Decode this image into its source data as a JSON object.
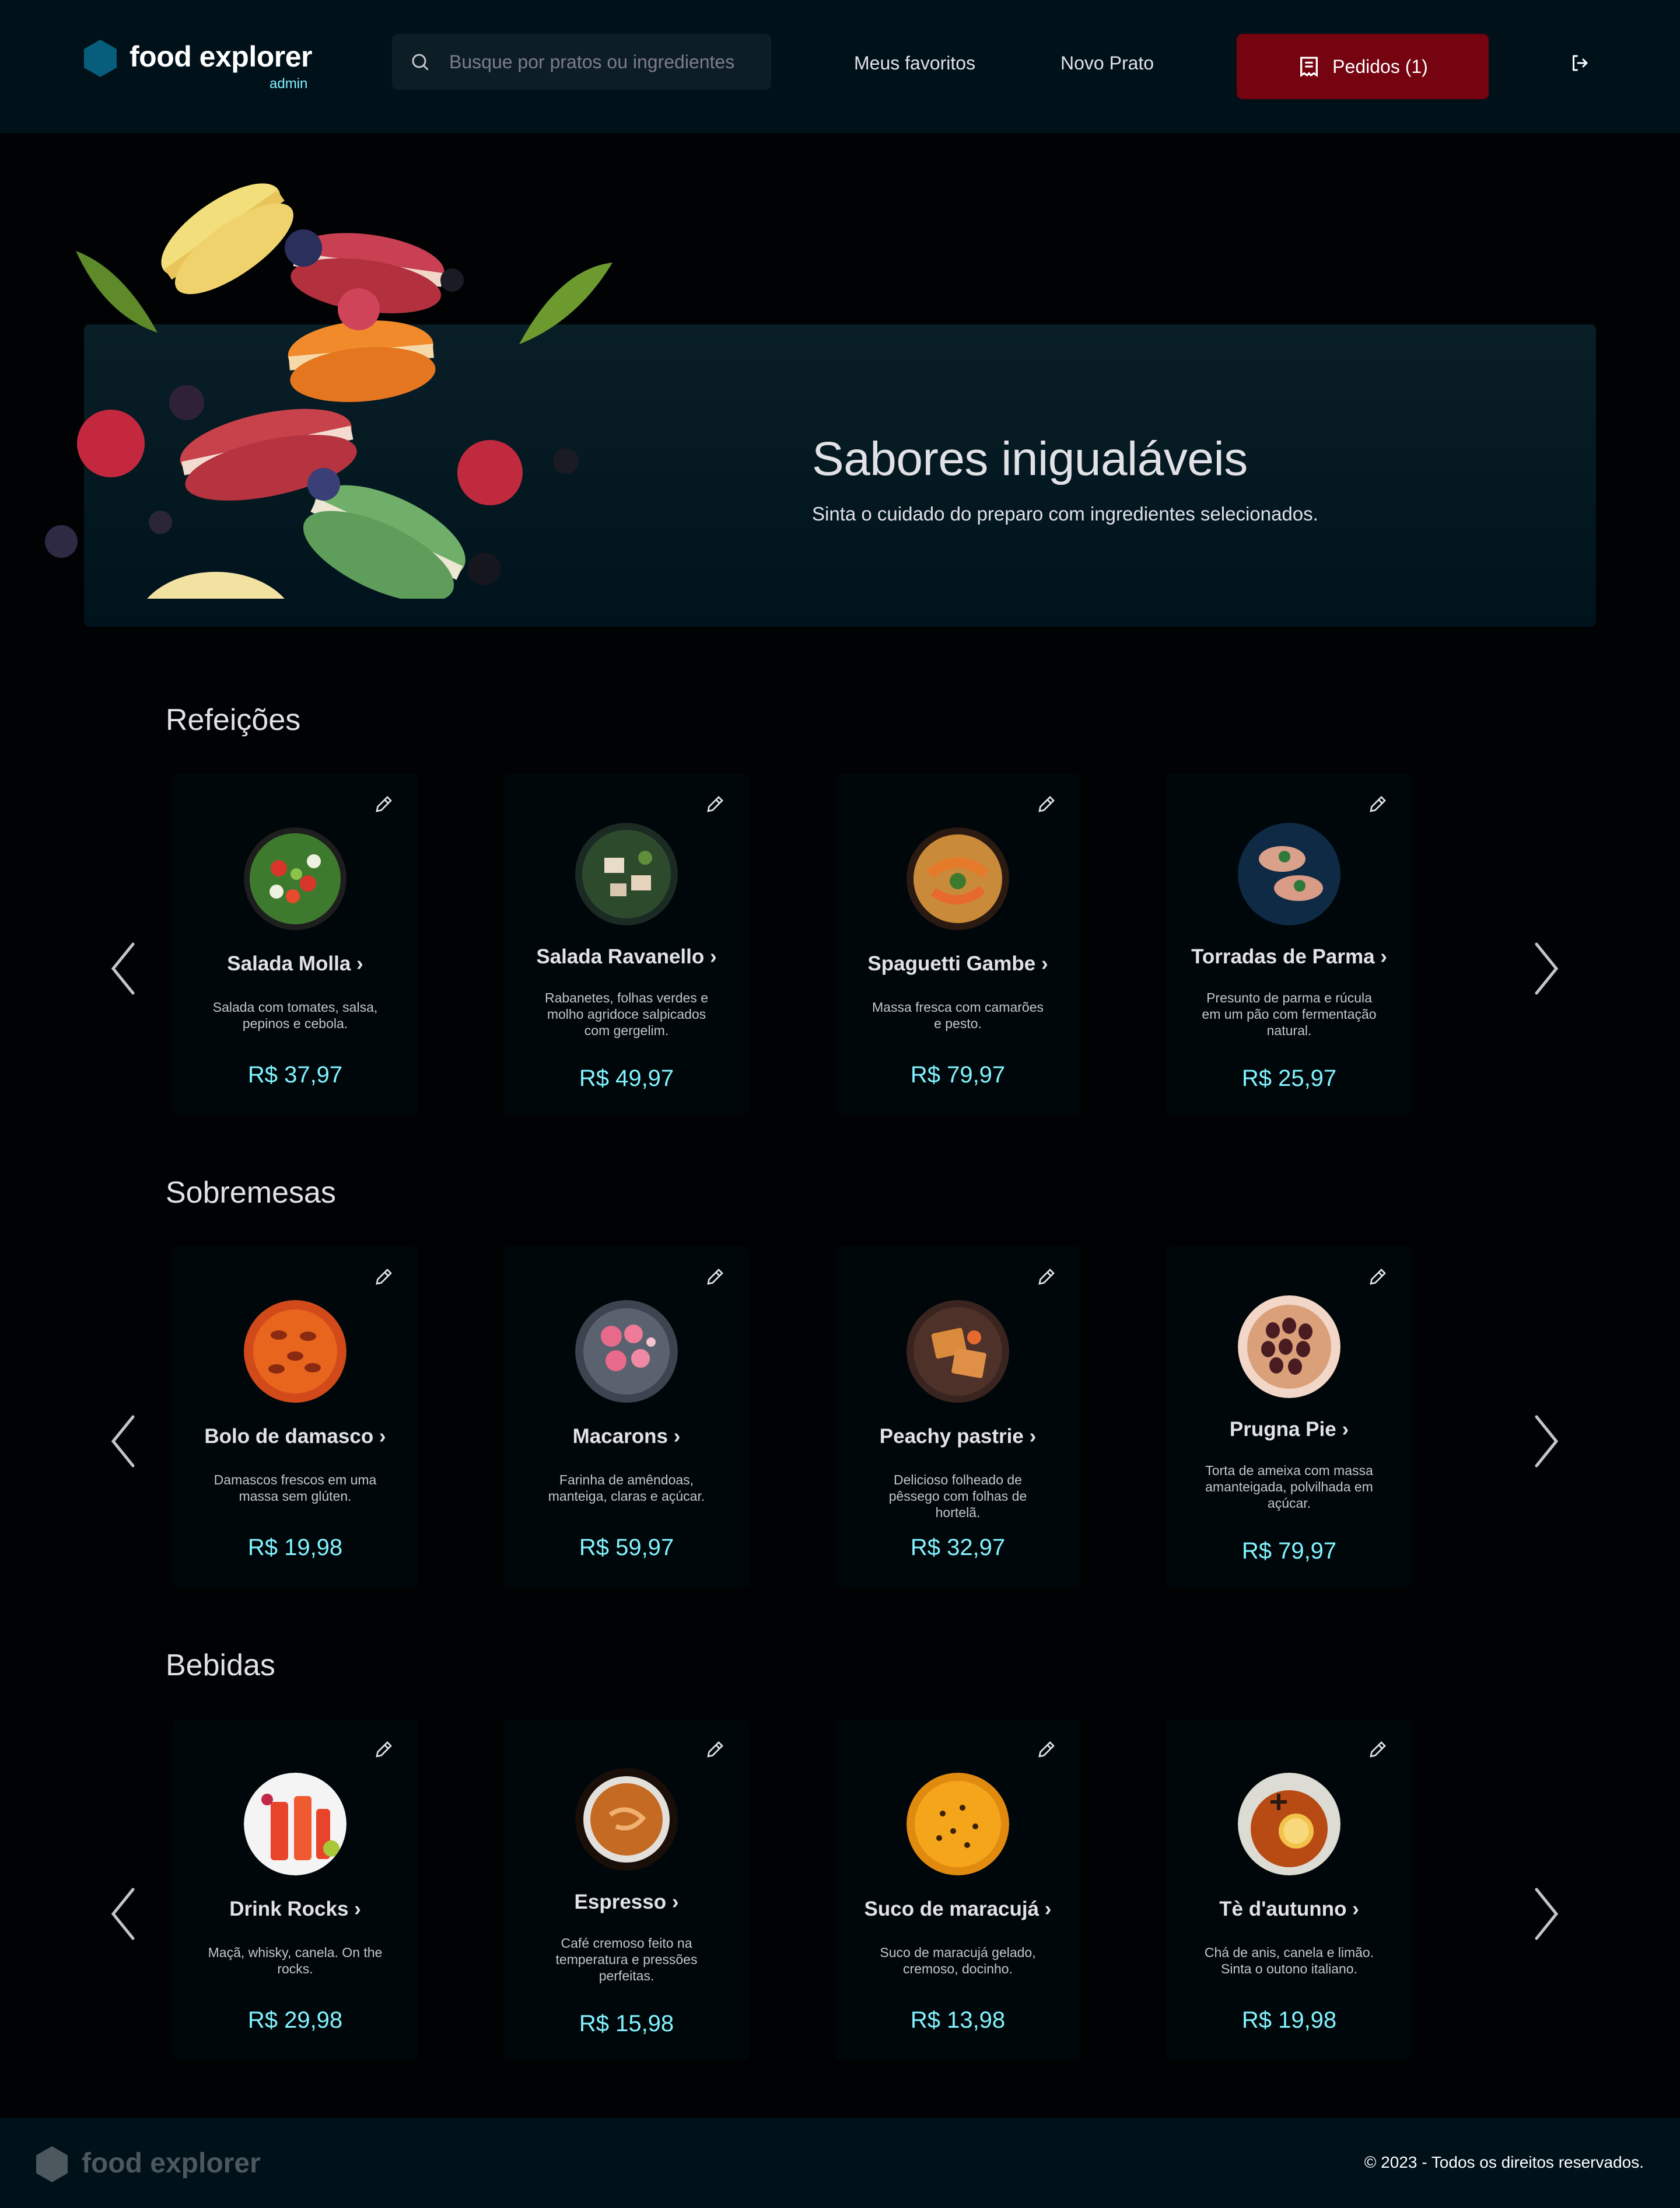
{
  "header": {
    "brand_name": "food explorer",
    "brand_role": "admin",
    "search_placeholder": "Busque por pratos ou ingredientes",
    "nav": {
      "favorites": "Meus favoritos",
      "new_dish": "Novo Prato"
    },
    "orders_label": "Pedidos (1)"
  },
  "banner": {
    "title": "Sabores inigualáveis",
    "subtitle": "Sinta o cuidado do preparo com ingredientes selecionados."
  },
  "sections": [
    {
      "title": "Refeições",
      "items": [
        {
          "name": "Salada Molla ›",
          "description": "Salada com tomates, salsa, pepinos e cebola.",
          "price": "R$ 37,97"
        },
        {
          "name": "Salada Ravanello ›",
          "description": "Rabanetes, folhas verdes e molho agridoce salpicados com gergelim.",
          "price": "R$ 49,97"
        },
        {
          "name": "Spaguetti Gambe ›",
          "description": "Massa fresca com camarões e pesto.",
          "price": "R$ 79,97"
        },
        {
          "name": "Torradas de Parma ›",
          "description": "Presunto de parma e rúcula em um pão com fermentação natural.",
          "price": "R$ 25,97"
        }
      ]
    },
    {
      "title": "Sobremesas",
      "items": [
        {
          "name": "Bolo de damasco ›",
          "description": "Damascos frescos em uma massa sem glúten.",
          "price": "R$ 19,98"
        },
        {
          "name": "Macarons ›",
          "description": "Farinha de amêndoas, manteiga, claras e açúcar.",
          "price": "R$ 59,97"
        },
        {
          "name": "Peachy pastrie ›",
          "description": "Delicioso folheado de pêssego com folhas de hortelã.",
          "price": "R$ 32,97"
        },
        {
          "name": "Prugna Pie ›",
          "description": "Torta de ameixa com massa amanteigada, polvilhada em açúcar.",
          "price": "R$ 79,97"
        }
      ]
    },
    {
      "title": "Bebidas",
      "items": [
        {
          "name": "Drink Rocks ›",
          "description": "Maçã, whisky, canela. On the rocks.",
          "price": "R$ 29,98"
        },
        {
          "name": "Espresso ›",
          "description": "Café cremoso feito na temperatura e pressões perfeitas.",
          "price": "R$ 15,98"
        },
        {
          "name": "Suco de maracujá ›",
          "description": "Suco de maracujá gelado, cremoso, docinho.",
          "price": "R$ 13,98"
        },
        {
          "name": "Tè d'autunno ›",
          "description": "Chá de anis, canela e limão. Sinta o outono italiano.",
          "price": "R$ 19,98"
        }
      ]
    }
  ],
  "footer": {
    "brand_name": "food explorer",
    "copyright": "© 2023 - Todos os direitos reservados."
  },
  "colors": {
    "background": "#000204",
    "header": "#00111A",
    "accent_red": "#750310",
    "price_cyan": "#82F3FF",
    "brand_blue": "#065E7C"
  }
}
